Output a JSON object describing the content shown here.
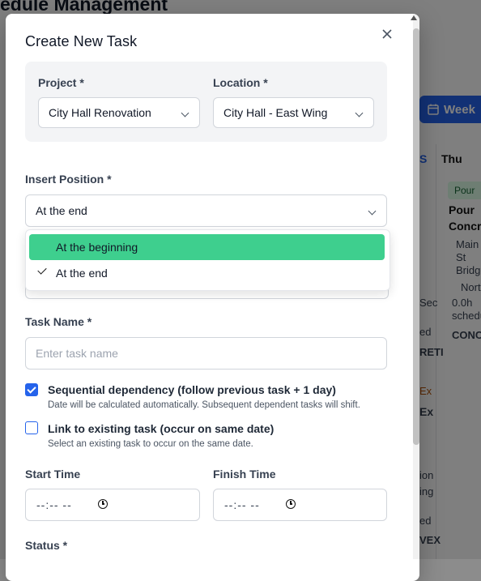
{
  "background": {
    "title": "edule Management",
    "week_label": "Week",
    "column_day": "Thu",
    "chip": "Pour",
    "fragments": {
      "a1": "Pour",
      "a2": "Concre",
      "a3": "Main",
      "a4": "St",
      "a5": "Bridge",
      "a6": "Nort",
      "a7": "0.0h",
      "a8": "schedu",
      "a9": "CONC",
      "b1": "Sec",
      "b2": "ed",
      "b3": "RETI",
      "b4": "Ex",
      "b5": "Ex",
      "b6": "ion",
      "b7": "ing",
      "b8": "ed",
      "b9": "VEX",
      "c1": "S"
    }
  },
  "modal": {
    "title": "Create New Task",
    "close_icon": "close-icon",
    "project": {
      "label": "Project *",
      "value": "City Hall Renovation"
    },
    "location": {
      "label": "Location *",
      "value": "City Hall - East Wing"
    },
    "insert_position": {
      "label": "Insert Position *",
      "value": "At the end",
      "options": [
        {
          "label": "At the beginning",
          "highlighted": true,
          "selected": false
        },
        {
          "label": "At the end",
          "highlighted": false,
          "selected": true
        }
      ]
    },
    "task_name": {
      "label": "Task Name *",
      "placeholder": "Enter task name"
    },
    "sequential": {
      "checked": true,
      "label": "Sequential dependency (follow previous task + 1 day)",
      "help": "Date will be calculated automatically. Subsequent dependent tasks will shift."
    },
    "link_existing": {
      "checked": false,
      "label": "Link to existing task (occur on same date)",
      "help": "Select an existing task to occur on the same date."
    },
    "start_time": {
      "label": "Start Time",
      "value": "--:-- --"
    },
    "finish_time": {
      "label": "Finish Time",
      "value": "--:-- --"
    },
    "status": {
      "label": "Status *"
    }
  },
  "colors": {
    "accent": "#2563eb",
    "highlight": "#3ecf8e"
  }
}
